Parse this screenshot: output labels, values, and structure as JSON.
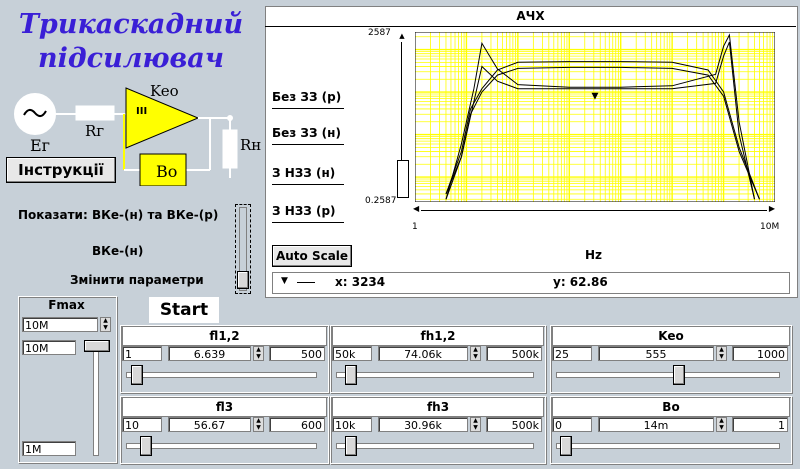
{
  "title_line1": "Трикаскадний",
  "title_line2": "підсилювач",
  "instructions_button": "Інструкції",
  "circuit": {
    "keo": "Keo",
    "stage": "III",
    "rg": "Rг",
    "eg": "Eг",
    "rn": "Rн",
    "bo": "Bo"
  },
  "show_label": "Показати: ВКе-(н) та ВКе-(р)",
  "vke_label": "ВКе-(н)",
  "change_params": "Змінити параметри",
  "start_button": "Start",
  "chart_title": "АЧХ",
  "chart_xlabel": "Hz",
  "auto_scale": "Auto Scale",
  "curve_buttons": [
    "Без ЗЗ (р)",
    "Без ЗЗ (н)",
    "З НЗЗ (н)",
    "З НЗЗ (р)"
  ],
  "cursor": {
    "x_label": "x: 3234",
    "y_label": "y: 62.86"
  },
  "chart_data": {
    "type": "line",
    "xscale": "log",
    "xlim": [
      1,
      10000000
    ],
    "ylim": [
      0.2587,
      2587
    ],
    "x_tick_labels": [
      "1",
      "10M"
    ],
    "y_tick_labels": [
      "2587",
      "0.2587"
    ],
    "xlabel": "Hz",
    "grid": true,
    "grid_color": "#ffff00",
    "series": [
      {
        "x": [
          4,
          8,
          14,
          20,
          40,
          100,
          1000,
          10000,
          100000,
          700000,
          1000000,
          1300000,
          2000000,
          4000000
        ],
        "y": [
          0.3,
          3,
          60,
          400,
          180,
          120,
          120,
          120,
          120,
          160,
          700,
          1500,
          10,
          0.3
        ]
      },
      {
        "x": [
          4,
          8,
          14,
          20,
          40,
          100,
          1000,
          10000,
          100000,
          700000,
          1000000,
          1300000,
          2000000,
          4000000
        ],
        "y": [
          0.3,
          6,
          120,
          1400,
          350,
          150,
          130,
          130,
          140,
          260,
          1200,
          2200,
          20,
          0.3
        ]
      },
      {
        "x": [
          4,
          8,
          12,
          20,
          40,
          100,
          1000,
          10000,
          100000,
          500000,
          1000000,
          2000000,
          5000000
        ],
        "y": [
          0.4,
          4,
          40,
          120,
          330,
          500,
          520,
          520,
          500,
          330,
          100,
          5,
          0.3
        ]
      },
      {
        "x": [
          4,
          8,
          12,
          20,
          40,
          100,
          1000,
          10000,
          100000,
          500000,
          1000000,
          2000000,
          5000000
        ],
        "y": [
          0.4,
          3,
          30,
          100,
          250,
          360,
          380,
          380,
          360,
          250,
          80,
          4,
          0.3
        ]
      }
    ]
  },
  "fmax": {
    "label": "Fmax",
    "value": "10M",
    "top_value": "10M",
    "bottom_value": "1M"
  },
  "sliders": [
    {
      "title": "fl1,2",
      "min": "1",
      "value": "6.639",
      "max": "500",
      "pos": 0.03
    },
    {
      "title": "fh1,2",
      "min": "50k",
      "value": "74.06k",
      "max": "500k",
      "pos": 0.05
    },
    {
      "title": "Keo",
      "min": "25",
      "value": "555",
      "max": "1000",
      "pos": 0.55
    },
    {
      "title": "fl3",
      "min": "10",
      "value": "56.67",
      "max": "600",
      "pos": 0.08
    },
    {
      "title": "fh3",
      "min": "10k",
      "value": "30.96k",
      "max": "500k",
      "pos": 0.05
    },
    {
      "title": "Bo",
      "min": "0",
      "value": "14m",
      "max": "1",
      "pos": 0.02
    }
  ],
  "colors": {
    "title": "#3a1fd6",
    "amp": "#ffff00",
    "grid": "#ffff00",
    "background": "#c7d0d8"
  }
}
